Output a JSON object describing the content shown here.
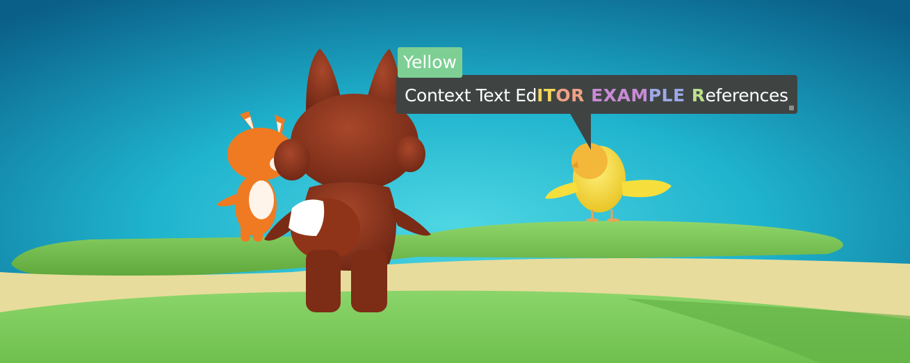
{
  "dialogue": {
    "speaker": "Yellow",
    "text_before": "Context Text Ed",
    "fx_segments": [
      {
        "text": "IT",
        "color": "#f3d65a"
      },
      {
        "text": "OR",
        "color": "#f0a184"
      },
      {
        "text": " EXAM",
        "color": "#c98bd6"
      },
      {
        "text": "PLE",
        "color": "#9fa8e8"
      },
      {
        "text": " R",
        "color": "#bde08e"
      }
    ],
    "text_after": "eferences"
  },
  "scene": {
    "characters": [
      "fox",
      "brown-fox-back",
      "yellow-bird"
    ],
    "colors": {
      "sky": "#22b8cf",
      "grass": "#7ccf55",
      "sand": "#e8dc9c",
      "fox": "#f07a22",
      "brown_fox": "#8f3418",
      "bird": "#f6df3c",
      "bubble": "#3f4443",
      "speaker_tag": "#7dcf94"
    }
  }
}
